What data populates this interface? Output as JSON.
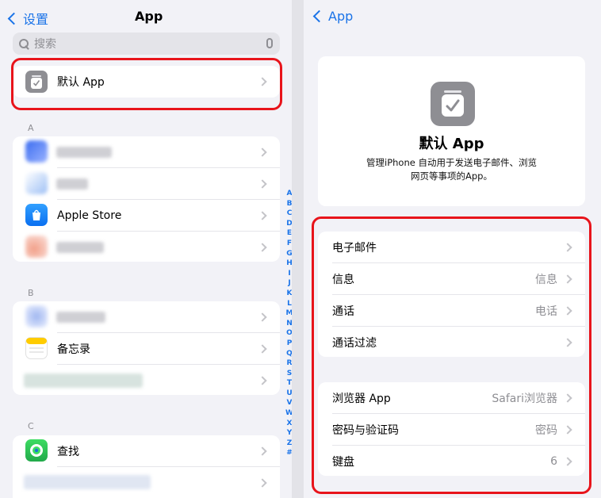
{
  "left": {
    "back_label": "设置",
    "title": "App",
    "search_placeholder": "搜索",
    "default_app_label": "默认 App",
    "sections": {
      "a": "A",
      "b": "B",
      "c": "C"
    },
    "apps": {
      "apple_store": "Apple Store",
      "notes": "备忘录",
      "find_my": "查找"
    },
    "index_letters": [
      "A",
      "B",
      "C",
      "D",
      "E",
      "F",
      "G",
      "H",
      "I",
      "J",
      "K",
      "L",
      "M",
      "N",
      "O",
      "P",
      "Q",
      "R",
      "S",
      "T",
      "U",
      "V",
      "W",
      "X",
      "Y",
      "Z",
      "#"
    ]
  },
  "right": {
    "back_label": "App",
    "hero": {
      "title": "默认 App",
      "description": "管理iPhone 自动用于发送电子邮件、浏览网页等事项的App。"
    },
    "group1": [
      {
        "label": "电子邮件",
        "value": ""
      },
      {
        "label": "信息",
        "value": "信息"
      },
      {
        "label": "通话",
        "value": "电话"
      },
      {
        "label": "通话过滤",
        "value": ""
      }
    ],
    "group2": [
      {
        "label": "浏览器 App",
        "value": "Safari浏览器"
      },
      {
        "label": "密码与验证码",
        "value": "密码"
      },
      {
        "label": "键盘",
        "value": "6"
      }
    ]
  },
  "colors": {
    "accent": "#1a73e8",
    "highlight": "#e8141b",
    "background": "#f2f2f7"
  }
}
